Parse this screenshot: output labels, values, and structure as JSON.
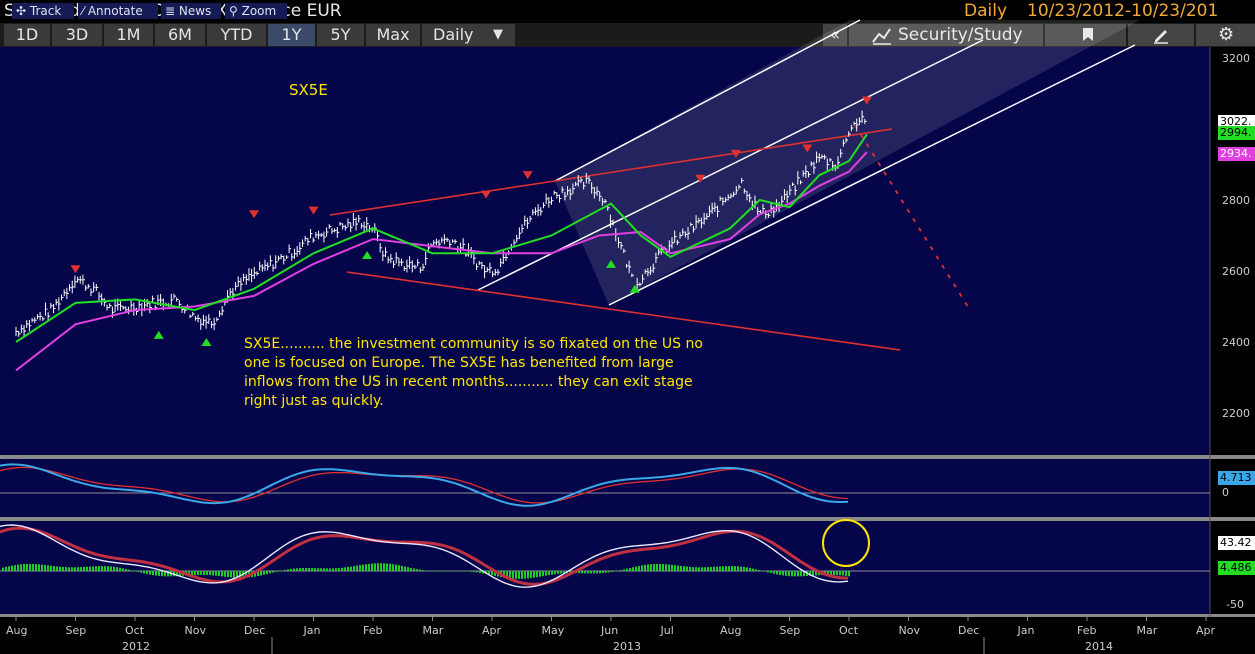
{
  "header": {
    "title": "SX5E Index : EURO STOXX 50 Price EUR",
    "frequency": "Daily",
    "date_range": "10/23/2012-10/23/201"
  },
  "toolbar": {
    "periods": [
      "1D",
      "3D",
      "1M",
      "6M",
      "YTD",
      "1Y",
      "5Y",
      "Max"
    ],
    "active_period": "1Y",
    "frequency_select": "Daily",
    "collapse_label": "«",
    "security_study_label": "Security/Study"
  },
  "tools": {
    "track": "Track",
    "annotate": "Annotate",
    "news": "News",
    "zoom": "Zoom"
  },
  "colors": {
    "background": "#05054a",
    "price_bars": "#ffffff",
    "ma_fast": "#22dd22",
    "ma_slow": "#e040e0",
    "trend_lines": "#e03030",
    "channel_lines": "#ffffff",
    "annotation_text": "#ffe600",
    "buy_marker": "#22dd22",
    "sell_marker": "#e03030",
    "macd_line": "#3aa8e8",
    "signal_line": "#e03030"
  },
  "chart_data": {
    "type": "line",
    "symbol_label": "SX5E",
    "annotation": "SX5E.......... the investment community is so fixated on the US no one is focused on Europe. The SX5E has benefited from large inflows from the US in recent months........... they can exit stage right just as quickly.",
    "x_labels": [
      "Aug",
      "Sep",
      "Oct",
      "Nov",
      "Dec",
      "Jan",
      "Feb",
      "Mar",
      "Apr",
      "May",
      "Jun",
      "Jul",
      "Aug",
      "Sep",
      "Oct",
      "Nov",
      "Dec",
      "Jan",
      "Feb",
      "Mar",
      "Apr"
    ],
    "year_labels": [
      "2012",
      "2013",
      "2014"
    ],
    "y_ticks": [
      2200,
      2400,
      2600,
      2800,
      3000,
      3200
    ],
    "ylim": [
      2140,
      3230
    ],
    "price_series": {
      "x": [
        0,
        0.6,
        1.0,
        1.3,
        1.6,
        2.0,
        2.3,
        2.7,
        3.0,
        3.3,
        3.6,
        3.9,
        4.1,
        4.4,
        4.7,
        5.0,
        5.4,
        5.8,
        6.0,
        6.2,
        6.5,
        6.8,
        7.0,
        7.3,
        7.6,
        7.9,
        8.1,
        8.4,
        8.7,
        9.0,
        9.3,
        9.6,
        9.9,
        10.1,
        10.4,
        10.7,
        10.9,
        11.2,
        11.6,
        11.9,
        12.2,
        12.5,
        12.8,
        13.2,
        13.5,
        13.8,
        14.0,
        14.2
      ],
      "values": [
        2430,
        2490,
        2580,
        2550,
        2490,
        2500,
        2510,
        2520,
        2470,
        2455,
        2540,
        2580,
        2600,
        2630,
        2660,
        2700,
        2720,
        2740,
        2720,
        2640,
        2620,
        2610,
        2680,
        2690,
        2650,
        2600,
        2610,
        2700,
        2760,
        2810,
        2830,
        2850,
        2800,
        2700,
        2560,
        2620,
        2660,
        2700,
        2750,
        2800,
        2850,
        2760,
        2780,
        2860,
        2920,
        2900,
        3000,
        3030
      ]
    },
    "ma_fast": {
      "x": [
        0,
        1.0,
        2.0,
        3.0,
        4.0,
        5.0,
        6.0,
        7.0,
        8.0,
        9.0,
        10.0,
        10.5,
        11.0,
        12.0,
        12.5,
        13.0,
        13.5,
        14.0,
        14.3
      ],
      "values": [
        2400,
        2510,
        2520,
        2490,
        2550,
        2650,
        2720,
        2650,
        2650,
        2700,
        2790,
        2700,
        2640,
        2720,
        2800,
        2780,
        2870,
        2910,
        2985
      ]
    },
    "ma_slow": {
      "x": [
        0,
        1.0,
        2.0,
        3.0,
        4.0,
        5.0,
        6.0,
        7.0,
        8.0,
        9.0,
        9.8,
        10.5,
        11.0,
        12.0,
        12.5,
        13.0,
        13.5,
        14.0,
        14.3
      ],
      "values": [
        2320,
        2450,
        2490,
        2500,
        2530,
        2620,
        2690,
        2670,
        2650,
        2650,
        2700,
        2710,
        2650,
        2690,
        2760,
        2790,
        2840,
        2880,
        2935
      ]
    },
    "last_values": {
      "price": "3022.",
      "ma_fast": "2994.",
      "ma_slow": "2934."
    },
    "markers": {
      "sell": [
        [
          1.0,
          2605
        ],
        [
          4.0,
          2760
        ],
        [
          5.0,
          2770
        ],
        [
          7.9,
          2815
        ],
        [
          8.6,
          2870
        ],
        [
          11.5,
          2860
        ],
        [
          12.1,
          2930
        ],
        [
          13.3,
          2945
        ],
        [
          14.3,
          3080
        ]
      ],
      "buy": [
        [
          2.4,
          2420
        ],
        [
          3.2,
          2400
        ],
        [
          5.9,
          2645
        ],
        [
          10.0,
          2620
        ],
        [
          10.4,
          2550
        ]
      ]
    },
    "macd_panel": {
      "last_value": "4.713",
      "zero_label": "0"
    },
    "macd_hist_panel": {
      "last_value": "43.42",
      "hist_value": "4.486",
      "low_label": "-50"
    }
  }
}
